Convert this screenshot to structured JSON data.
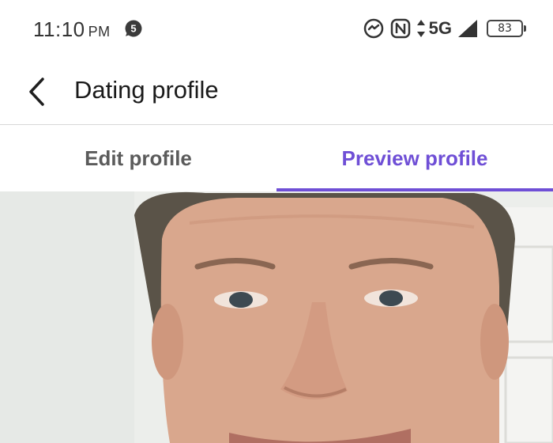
{
  "status_bar": {
    "time": "11:10",
    "ampm": "PM",
    "notification_count": "5",
    "network": "5G",
    "battery": "83"
  },
  "header": {
    "title": "Dating profile"
  },
  "tabs": [
    {
      "label": "Edit profile",
      "selected": false
    },
    {
      "label": "Preview profile",
      "selected": true
    }
  ],
  "colors": {
    "accent": "#6f4fd6",
    "tab_inactive": "#5b5b5b"
  },
  "icons": [
    "chat-badge-icon",
    "sync-icon",
    "nfc-icon",
    "data-arrows-icon",
    "signal-icon",
    "battery-icon",
    "back-arrow-icon"
  ]
}
